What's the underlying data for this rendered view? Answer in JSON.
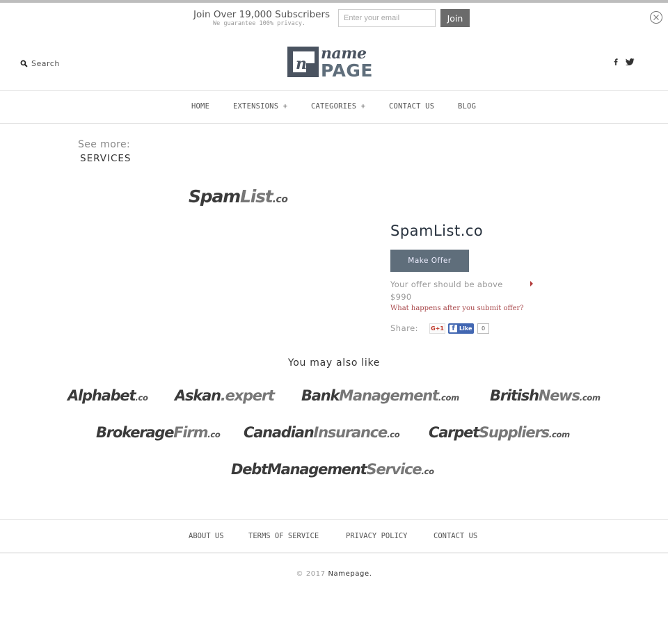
{
  "newsletter": {
    "title": "Join Over 19,000 Subscribers",
    "subtitle": "We guarantee 100% privacy.",
    "email_placeholder": "Enter your email",
    "email_value": "",
    "join_label": "Join",
    "close_icon": "close-circle-icon"
  },
  "header": {
    "search_label": "Search",
    "search_icon": "search-icon",
    "logo": {
      "line1": "name",
      "line2": "PAGE",
      "mark": "n"
    },
    "social": [
      {
        "name": "facebook",
        "icon": "facebook-icon"
      },
      {
        "name": "twitter",
        "icon": "twitter-icon"
      }
    ]
  },
  "nav": {
    "items": [
      {
        "label": "HOME"
      },
      {
        "label": "EXTENSIONS +"
      },
      {
        "label": "CATEGORIES +"
      },
      {
        "label": "CONTACT US"
      },
      {
        "label": "BLOG"
      }
    ]
  },
  "breadcrumb": {
    "see_more": "See more:",
    "category": "SERVICES"
  },
  "product": {
    "logo": {
      "part1": "Spam",
      "part2": "List",
      "tld": ".co"
    },
    "title": "SpamList.co",
    "make_offer_label": "Make Offer",
    "offer_note": "Your offer should be above",
    "min_offer": "$990",
    "help_link": "What happens after you submit offer?",
    "share_label": "Share:",
    "gplus_label": "G+1",
    "fb_label": "Like",
    "fb_count": "0",
    "colors": {
      "button": "#5f6e7b",
      "link": "#a8474a"
    }
  },
  "related": {
    "heading": "You may also like",
    "items": [
      {
        "part1": "Alphabet",
        "part2": "",
        "tld": ".co"
      },
      {
        "part1": "Askan",
        "part2": ".expert",
        "tld": ""
      },
      {
        "part1": "Bank",
        "part2": "Management",
        "tld": ".com"
      },
      {
        "part1": "British",
        "part2": "News",
        "tld": ".com"
      },
      {
        "part1": "Brokerage",
        "part2": "Firm",
        "tld": ".co"
      },
      {
        "part1": "Canadian",
        "part2": "Insurance",
        "tld": ".co"
      },
      {
        "part1": "Carpet",
        "part2": "Suppliers",
        "tld": ".com"
      },
      {
        "part1": "DebtManagement",
        "part2": "Service",
        "tld": ".co"
      }
    ]
  },
  "footer": {
    "links": [
      {
        "label": "ABOUT US"
      },
      {
        "label": "TERMS OF SERVICE"
      },
      {
        "label": "PRIVACY POLICY"
      },
      {
        "label": "CONTACT US"
      }
    ],
    "copyright_prefix": "© 2017",
    "brand": "Namepage."
  }
}
